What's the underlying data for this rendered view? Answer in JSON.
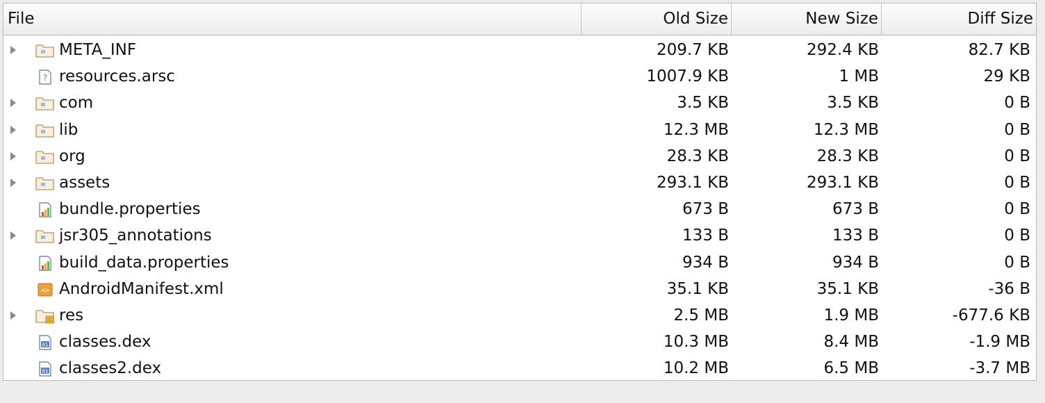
{
  "table": {
    "columns": {
      "file": "File",
      "old_size": "Old Size",
      "new_size": "New Size",
      "diff_size": "Diff Size"
    },
    "rows": [
      {
        "name": "META_INF",
        "icon": "folder-icon",
        "expandable": true,
        "old": "209.7 KB",
        "new": "292.4 KB",
        "diff": "82.7 KB"
      },
      {
        "name": "resources.arsc",
        "icon": "unknown-file-icon",
        "expandable": false,
        "old": "1007.9 KB",
        "new": "1 MB",
        "diff": "29 KB"
      },
      {
        "name": "com",
        "icon": "folder-icon",
        "expandable": true,
        "old": "3.5 KB",
        "new": "3.5 KB",
        "diff": "0 B"
      },
      {
        "name": "lib",
        "icon": "folder-icon",
        "expandable": true,
        "old": "12.3 MB",
        "new": "12.3 MB",
        "diff": "0 B"
      },
      {
        "name": "org",
        "icon": "folder-icon",
        "expandable": true,
        "old": "28.3 KB",
        "new": "28.3 KB",
        "diff": "0 B"
      },
      {
        "name": "assets",
        "icon": "folder-icon",
        "expandable": true,
        "old": "293.1 KB",
        "new": "293.1 KB",
        "diff": "0 B"
      },
      {
        "name": "bundle.properties",
        "icon": "properties-file-icon",
        "expandable": false,
        "old": "673 B",
        "new": "673 B",
        "diff": "0 B"
      },
      {
        "name": "jsr305_annotations",
        "icon": "folder-icon",
        "expandable": true,
        "old": "133 B",
        "new": "133 B",
        "diff": "0 B"
      },
      {
        "name": "build_data.properties",
        "icon": "properties-file-icon",
        "expandable": false,
        "old": "934 B",
        "new": "934 B",
        "diff": "0 B"
      },
      {
        "name": "AndroidManifest.xml",
        "icon": "xml-file-icon",
        "expandable": false,
        "old": "35.1 KB",
        "new": "35.1 KB",
        "diff": "-36 B"
      },
      {
        "name": "res",
        "icon": "resource-folder-icon",
        "expandable": true,
        "old": "2.5 MB",
        "new": "1.9 MB",
        "diff": "-677.6 KB"
      },
      {
        "name": "classes.dex",
        "icon": "dex-file-icon",
        "expandable": false,
        "old": "10.3 MB",
        "new": "8.4 MB",
        "diff": "-1.9 MB"
      },
      {
        "name": "classes2.dex",
        "icon": "dex-file-icon",
        "expandable": false,
        "old": "10.2 MB",
        "new": "6.5 MB",
        "diff": "-3.7 MB"
      }
    ]
  },
  "colors": {
    "folder": "#c9a46a",
    "folder_badge": "#5b8fc7",
    "xml_icon": "#e8a33d",
    "dex_icon": "#5b87c0",
    "disclosure": "#8a8a8a"
  }
}
